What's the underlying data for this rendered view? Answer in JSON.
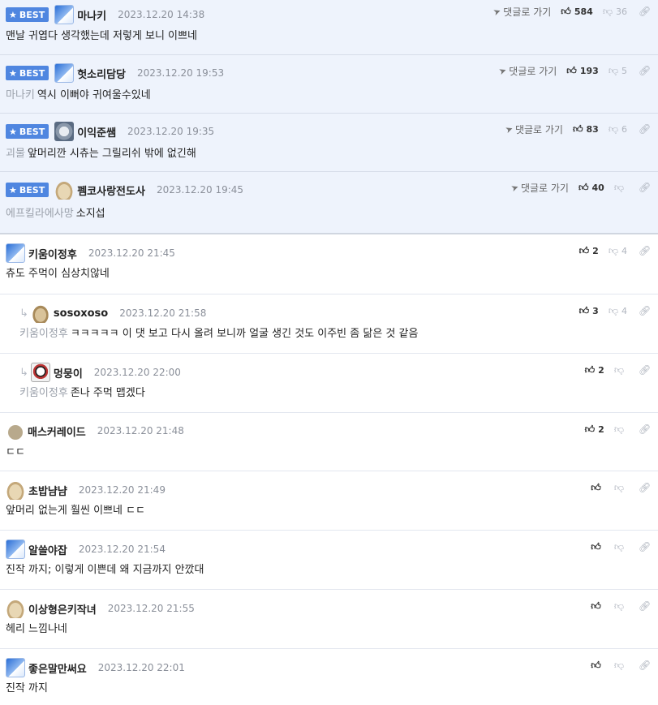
{
  "best_label": "BEST",
  "goto_label": "댓글로 가기",
  "comments": [
    {
      "nick": "마나키",
      "date": "2023.12.20 14:38",
      "ref": "",
      "text": "맨날 귀엽다 생각했는데 저렇게 보니 이쁘네",
      "up": "584",
      "down": "36",
      "best": true
    },
    {
      "nick": "헛소리담당",
      "date": "2023.12.20 19:53",
      "ref": "마나키",
      "text": "역시 이뻐야 귀여울수있네",
      "up": "193",
      "down": "5",
      "best": true
    },
    {
      "nick": "이익준쌤",
      "date": "2023.12.20 19:35",
      "ref": "괴물",
      "text": "앞머리깐 시츄는 그릴리쉬 밖에 없긴해",
      "up": "83",
      "down": "6",
      "best": true
    },
    {
      "nick": "펨코사랑전도사",
      "date": "2023.12.20 19:45",
      "ref": "에프킬라에사망",
      "text": "소지섭",
      "up": "40",
      "down": "",
      "best": true
    },
    {
      "nick": "키움이정후",
      "date": "2023.12.20 21:45",
      "ref": "",
      "text": "츄도 주먹이 심상치않네",
      "up": "2",
      "down": "4"
    },
    {
      "nick": "sosoxoso",
      "date": "2023.12.20 21:58",
      "ref": "키움이정후",
      "text": "ㅋㅋㅋㅋㅋ 이 댓 보고 다시 올려 보니까 얼굴 생긴 것도 이주빈 좀 닮은 것 같음",
      "up": "3",
      "down": "4"
    },
    {
      "nick": "멍뭉이",
      "date": "2023.12.20 22:00",
      "ref": "키움이정후",
      "text": "존나 주먹 맵겠다",
      "up": "2",
      "down": ""
    },
    {
      "nick": "매스커레이드",
      "date": "2023.12.20 21:48",
      "ref": "",
      "text": "ㄷㄷ",
      "up": "2",
      "down": ""
    },
    {
      "nick": "초밥냠냠",
      "date": "2023.12.20 21:49",
      "ref": "",
      "text": "앞머리 없는게 훨씬 이쁘네 ㄷㄷ",
      "up": "",
      "down": ""
    },
    {
      "nick": "알쓸야잡",
      "date": "2023.12.20 21:54",
      "ref": "",
      "text": "진작 까지; 이렇게 이쁜데 왜 지금까지 안깠대",
      "up": "",
      "down": ""
    },
    {
      "nick": "이상형은키작녀",
      "date": "2023.12.20 21:55",
      "ref": "",
      "text": "헤리 느낌나네",
      "up": "",
      "down": ""
    },
    {
      "nick": "좋은말만써요",
      "date": "2023.12.20 22:01",
      "ref": "",
      "text": "진작 까지",
      "up": "",
      "down": ""
    }
  ]
}
